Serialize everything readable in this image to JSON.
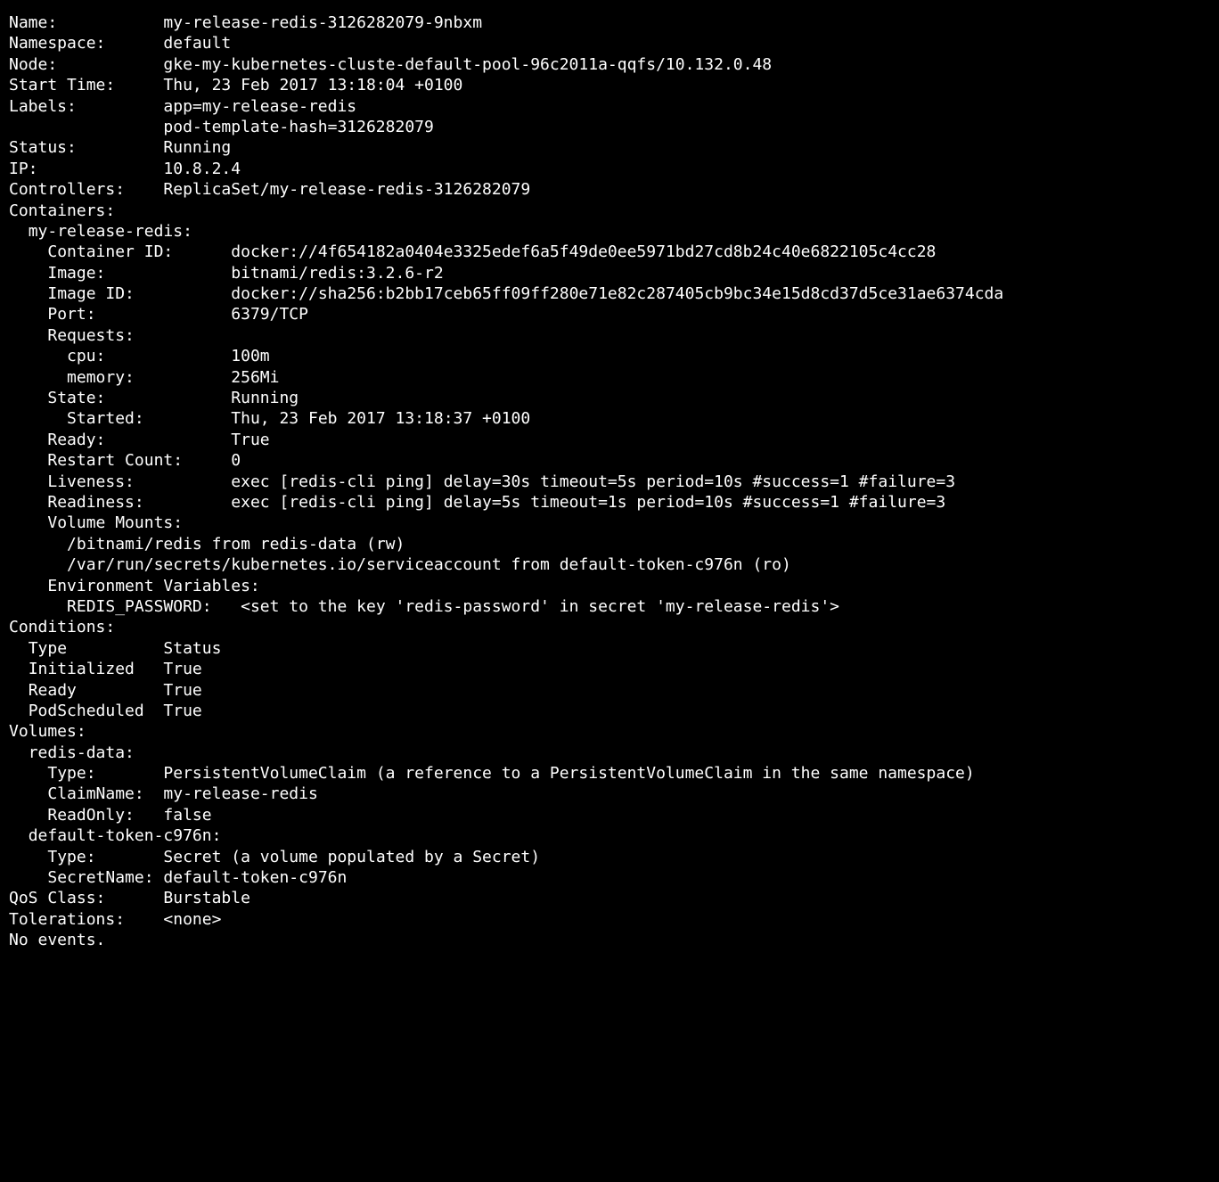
{
  "labels": {
    "name": "Name:",
    "namespace": "Namespace:",
    "node": "Node:",
    "starttime": "Start Time:",
    "labels_": "Labels:",
    "status": "Status:",
    "ip": "IP:",
    "controllers": "Controllers:",
    "containers_hdr": "Containers:",
    "container_id": "Container ID:",
    "image": "Image:",
    "image_id": "Image ID:",
    "port": "Port:",
    "requests": "Requests:",
    "cpu": "cpu:",
    "memory": "memory:",
    "state": "State:",
    "started": "Started:",
    "ready": "Ready:",
    "restart_count": "Restart Count:",
    "liveness": "Liveness:",
    "readiness": "Readiness:",
    "volume_mounts": "Volume Mounts:",
    "env_vars": "Environment Variables:",
    "redis_password": "REDIS_PASSWORD:",
    "conditions": "Conditions:",
    "cond_type": "Type",
    "cond_status": "Status",
    "cond_init": "Initialized",
    "cond_ready": "Ready",
    "cond_sched": "PodScheduled",
    "volumes": "Volumes:",
    "vol_type": "Type:",
    "vol_claimname": "ClaimName:",
    "vol_readonly": "ReadOnly:",
    "vol_secretname": "SecretName:",
    "qos": "QoS Class:",
    "tolerations": "Tolerations:",
    "no_events": "No events."
  },
  "values": {
    "name": "my-release-redis-3126282079-9nbxm",
    "namespace": "default",
    "node": "gke-my-kubernetes-cluste-default-pool-96c2011a-qqfs/10.132.0.48",
    "starttime": "Thu, 23 Feb 2017 13:18:04 +0100",
    "label1": "app=my-release-redis",
    "label2": "pod-template-hash=3126282079",
    "status": "Running",
    "ip": "10.8.2.4",
    "controllers": "ReplicaSet/my-release-redis-3126282079",
    "container_name": "my-release-redis:",
    "container_id": "docker://4f654182a0404e3325edef6a5f49de0ee5971bd27cd8b24c40e6822105c4cc28",
    "image": "bitnami/redis:3.2.6-r2",
    "image_id": "docker://sha256:b2bb17ceb65ff09ff280e71e82c287405cb9bc34e15d8cd37d5ce31ae6374cda",
    "port": "6379/TCP",
    "cpu": "100m",
    "memory": "256Mi",
    "state": "Running",
    "started": "Thu, 23 Feb 2017 13:18:37 +0100",
    "ready": "True",
    "restart_count": "0",
    "liveness": "exec [redis-cli ping] delay=30s timeout=5s period=10s #success=1 #failure=3",
    "readiness": "exec [redis-cli ping] delay=5s timeout=1s period=10s #success=1 #failure=3",
    "mount1": "/bitnami/redis from redis-data (rw)",
    "mount2": "/var/run/secrets/kubernetes.io/serviceaccount from default-token-c976n (ro)",
    "redis_password": "<set to the key 'redis-password' in secret 'my-release-redis'>",
    "cond_init": "True",
    "cond_ready": "True",
    "cond_sched": "True",
    "vol_redisdata_name": "redis-data:",
    "vol_redisdata_type": "PersistentVolumeClaim (a reference to a PersistentVolumeClaim in the same namespace)",
    "vol_redisdata_claim": "my-release-redis",
    "vol_redisdata_readonly": "false",
    "vol_token_name": "default-token-c976n:",
    "vol_token_type": "Secret (a volume populated by a Secret)",
    "vol_token_secret": "default-token-c976n",
    "qos": "Burstable",
    "tolerations": "<none>"
  }
}
